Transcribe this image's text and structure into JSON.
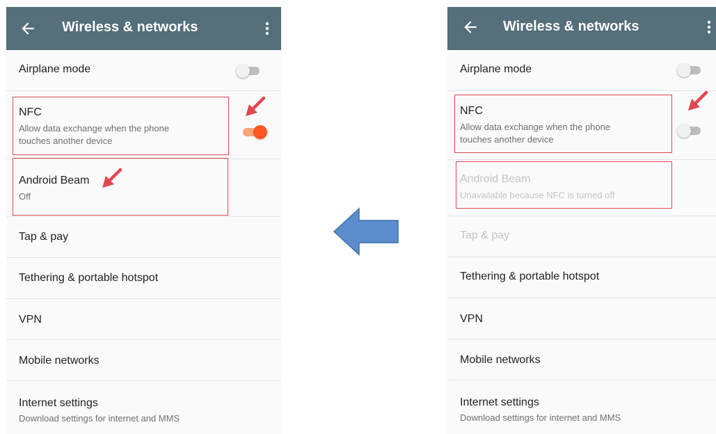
{
  "left_screen": {
    "toolbar": {
      "title": "Wireless & networks",
      "back_icon": "arrow-left-icon",
      "menu_icon": "more-vert-icon"
    },
    "airplane": {
      "label": "Airplane mode",
      "switch_on": false
    },
    "nfc": {
      "label": "NFC",
      "summary_line1": "Allow data exchange when the phone",
      "summary_line2": "touches another device",
      "switch_on": true
    },
    "android_beam": {
      "label": "Android Beam",
      "summary": "Off"
    },
    "tap_pay": {
      "label": "Tap & pay"
    },
    "tethering": {
      "label": "Tethering & portable hotspot"
    },
    "vpn": {
      "label": "VPN"
    },
    "mobile_networks": {
      "label": "Mobile networks"
    },
    "internet_settings": {
      "label": "Internet settings",
      "summary": "Download settings for internet and MMS"
    }
  },
  "right_screen": {
    "toolbar": {
      "title": "Wireless & networks",
      "back_icon": "arrow-left-icon",
      "menu_icon": "more-vert-icon"
    },
    "airplane": {
      "label": "Airplane mode",
      "switch_on": false
    },
    "nfc": {
      "label": "NFC",
      "summary_line1": "Allow data exchange when the phone",
      "summary_line2": "touches another device",
      "switch_on": false
    },
    "android_beam": {
      "label": "Android Beam",
      "summary": "Unavailable because NFC is turned off"
    },
    "tap_pay": {
      "label": "Tap & pay"
    },
    "tethering": {
      "label": "Tethering & portable hotspot"
    },
    "vpn": {
      "label": "VPN"
    },
    "mobile_networks": {
      "label": "Mobile networks"
    },
    "internet_settings": {
      "label": "Internet settings",
      "summary": "Download settings for internet and MMS"
    }
  },
  "colors": {
    "toolbar": "#546e7a",
    "accent": "#ff5722",
    "annotation": "#e0474f",
    "direction_arrow": "#5b8ccc"
  },
  "annotation_icons": [
    "red-arrow-icon",
    "blue-left-arrow-icon"
  ]
}
